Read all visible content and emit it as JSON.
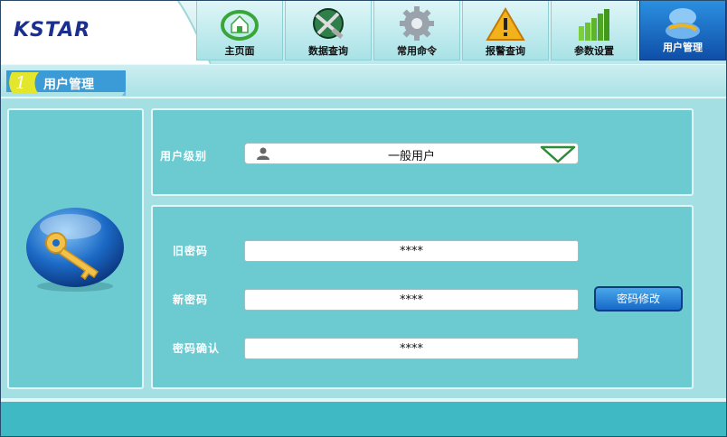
{
  "app": {
    "logo": "KSTAR"
  },
  "tabs": [
    {
      "label": "主页面",
      "icon": "home-icon",
      "active": false
    },
    {
      "label": "数据查询",
      "icon": "data-query-icon",
      "active": false
    },
    {
      "label": "常用命令",
      "icon": "gear-icon",
      "active": false
    },
    {
      "label": "报警查询",
      "icon": "warning-icon",
      "active": false
    },
    {
      "label": "参数设置",
      "icon": "bars-icon",
      "active": false
    },
    {
      "label": "用户管理",
      "icon": "user-manage-icon",
      "active": true
    }
  ],
  "section": {
    "number": "1",
    "title": "用户管理"
  },
  "user_level": {
    "label": "用户级别",
    "value": "一般用户"
  },
  "passwords": {
    "old_label": "旧密码",
    "old_value": "****",
    "new_label": "新密码",
    "new_value": "****",
    "confirm_label": "密码确认",
    "confirm_value": "****",
    "change_button": "密码修改"
  },
  "colors": {
    "accent": "#1768c7",
    "panel": "#6ccad1",
    "footer": "#3fb9c4"
  }
}
